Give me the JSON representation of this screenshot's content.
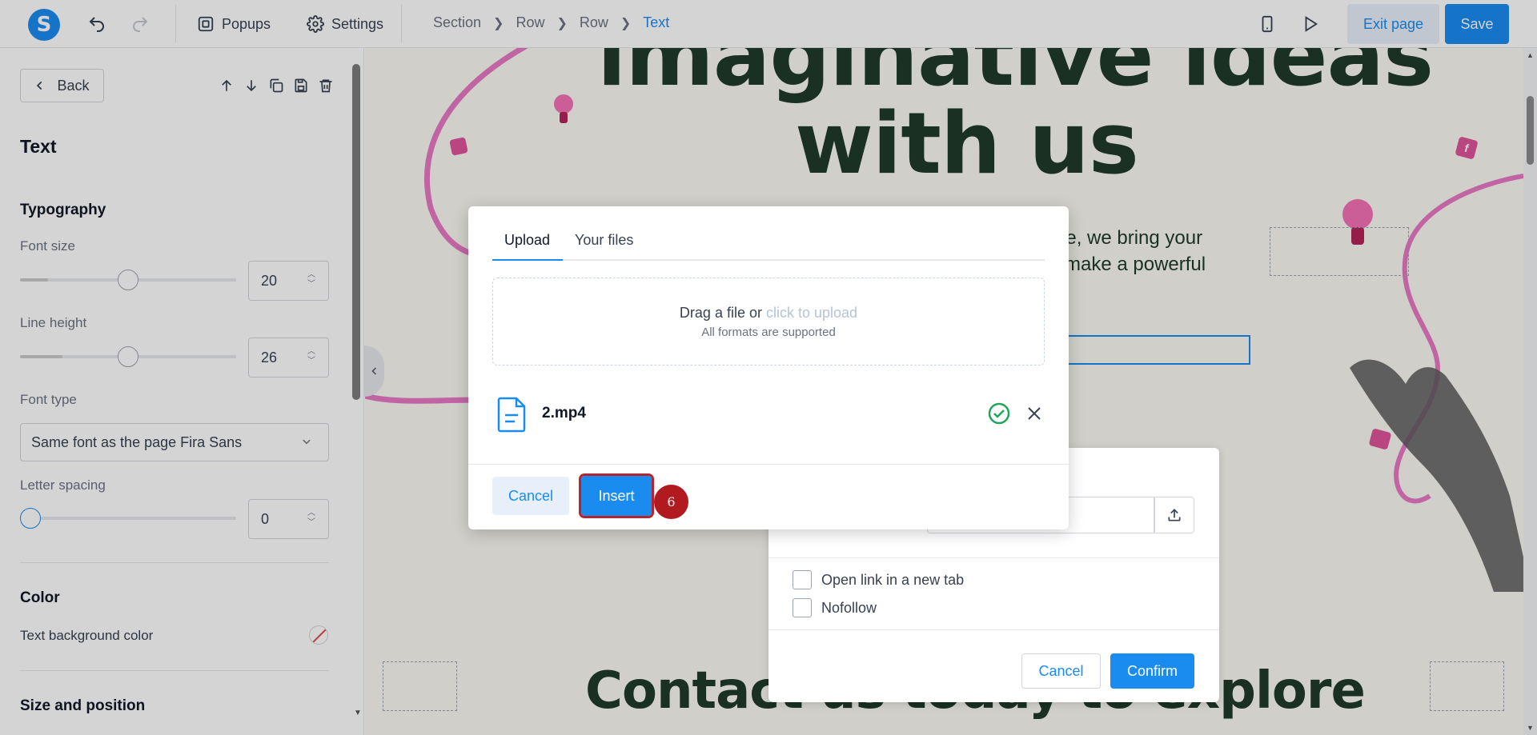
{
  "topbar": {
    "logo_letter": "S",
    "popups_label": "Popups",
    "settings_label": "Settings",
    "breadcrumb": [
      "Section",
      "Row",
      "Row",
      "Text"
    ],
    "exit_label": "Exit page",
    "save_label": "Save"
  },
  "panel": {
    "back_label": "Back",
    "title": "Text",
    "typography_heading": "Typography",
    "font_size_label": "Font size",
    "font_size_value": "20",
    "line_height_label": "Line height",
    "line_height_value": "26",
    "font_type_label": "Font type",
    "font_type_value": "Same font as the page Fira Sans",
    "letter_spacing_label": "Letter spacing",
    "letter_spacing_value": "0",
    "color_heading": "Color",
    "text_bg_label": "Text background color",
    "size_position_heading": "Size and position"
  },
  "canvas": {
    "hero_line1": "imaginative ideas",
    "hero_line2": "with us",
    "hero_text1": "ore, we bring your",
    "hero_text2": "make a powerful",
    "contact_heading": "Contact us today to explore"
  },
  "link_dialog": {
    "open_new_tab_label": "Open link in a new tab",
    "nofollow_label": "Nofollow",
    "cancel_label": "Cancel",
    "confirm_label": "Confirm"
  },
  "upload_modal": {
    "tab_upload": "Upload",
    "tab_files": "Your files",
    "drop_text": "Drag a file or",
    "drop_link": "click to upload",
    "drop_sub": "All formats are supported",
    "file_name": "2.mp4",
    "cancel_label": "Cancel",
    "insert_label": "Insert"
  },
  "step_badge": "6",
  "colors": {
    "accent": "#1a8cf0",
    "heading_green": "#1f3a2b",
    "decor_pink": "#e879c6",
    "badge_red": "#b11a1f"
  }
}
